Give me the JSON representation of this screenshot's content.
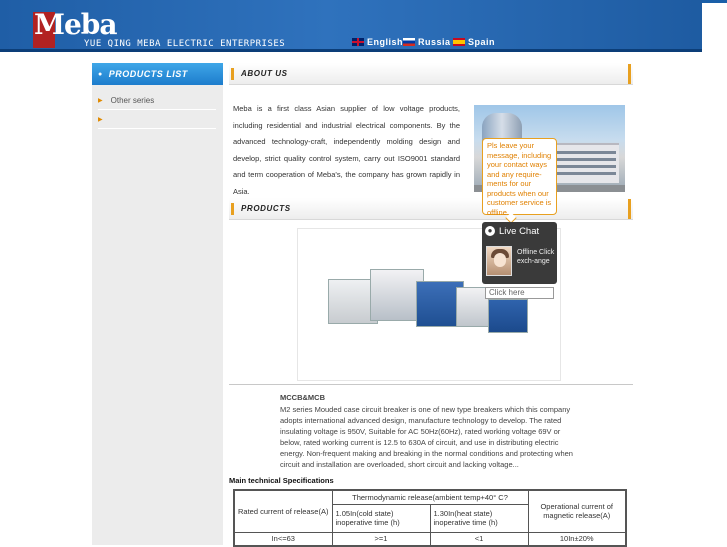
{
  "header": {
    "logo_text": "Meba",
    "company_name": "YUE QING MEBA ELECTRIC ENTERPRISES",
    "languages": [
      {
        "label": "English",
        "icon": "uk-flag-icon"
      },
      {
        "label": "Russia",
        "icon": "russia-flag-icon"
      },
      {
        "label": "Spain",
        "icon": "spain-flag-icon"
      }
    ]
  },
  "sidebar": {
    "title": "PRODUCTS LIST",
    "items": [
      {
        "label": "Other series"
      },
      {
        "label": ""
      }
    ]
  },
  "about": {
    "title": "ABOUT US",
    "text": "Meba is a first class Asian supplier of low voltage products, including residential and industrial electrical components. By the advanced technology-craft, independently molding design and develop, strict quality control system, carry out ISO9001 standard and term cooperation of Meba's, the company has grown rapidly in Asia."
  },
  "products": {
    "title": "PRODUCTS",
    "mccb_title": "MCCB&MCB",
    "mccb_desc": "M2 series Mouded case circuit breaker is one of new type breakers which this company adopts international advanced design, manufacture technology to develop. The rated insulating voltage is 950V, Suitable for AC 50Hz(60Hz), rated working voltage 69V or below, rated working current is 12.5 to 630A of circuit, and use in distributing electric energy. Non-frequent making and breaking in the normal conditions and protecting when circuit and installation are overloaded, short circuit and lacking voltage...",
    "spec_title": "Main technical Specifications"
  },
  "spec_table": {
    "col1": "Rated current of release(A)",
    "thermo_header": "Thermodynamic release(ambient temp+40° C?",
    "cold": "1.05In(cold state) inoperative time (h)",
    "heat": "1.30In(heat state) inoperative time (h)",
    "magnetic": "Operational current of magnetic release(A)",
    "row1": [
      "In<=63",
      ">=1",
      "<1",
      "10In±20%"
    ]
  },
  "chat": {
    "bubble_text": "Pls leave your message, including your contact ways and any require-ments for our products when our customer service is offline.",
    "title": "Live Chat",
    "status": "Offline Click exch-ange",
    "input_value": "Click here"
  }
}
